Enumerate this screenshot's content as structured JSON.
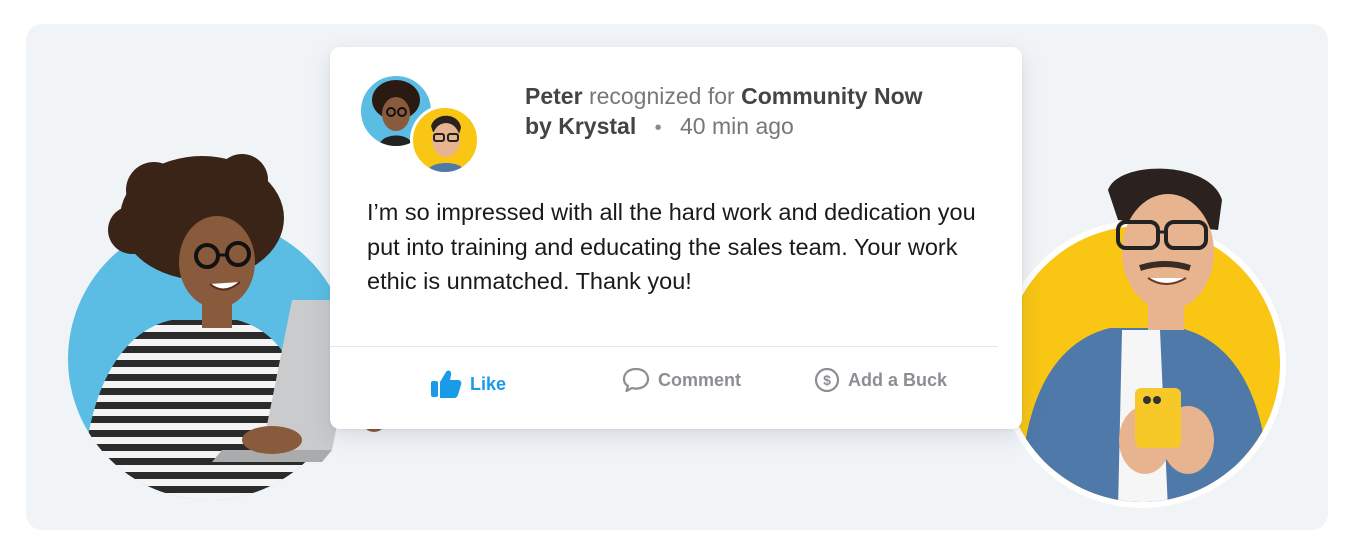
{
  "post": {
    "recipient": "Peter",
    "recognized_text": "recognized for",
    "award": "Community Now",
    "by_text": "by Krystal",
    "separator": "•",
    "time_ago": "40 min ago",
    "message": "I’m so impressed with all the hard work and dedication you put into training and educating the sales team. Your work ethic is unmatched. Thank you!"
  },
  "actions": {
    "like_label": "Like",
    "comment_label": "Comment",
    "buck_label": "Add a Buck"
  },
  "colors": {
    "accent": "#1a9be8",
    "blue_circle": "#5bbde4",
    "yellow_circle": "#f9c613",
    "muted": "#8b8f94"
  }
}
